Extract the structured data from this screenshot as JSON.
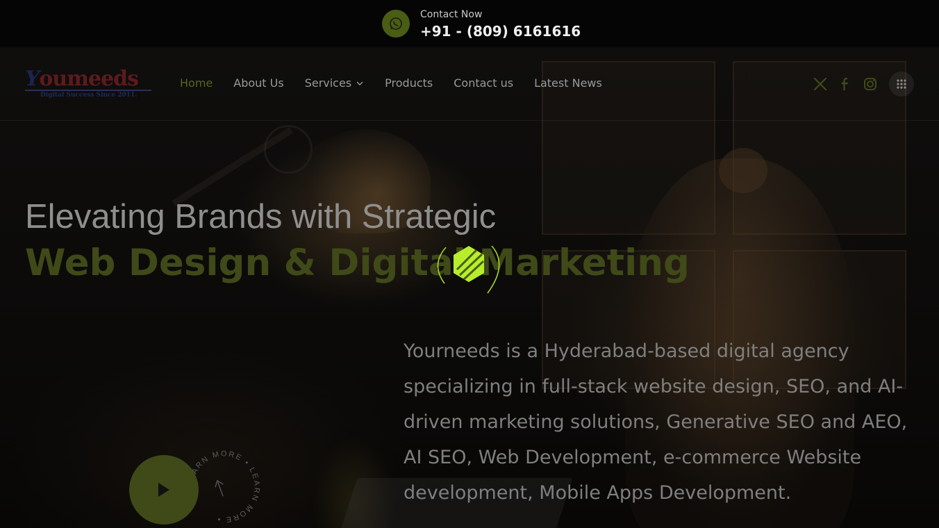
{
  "contact": {
    "label": "Contact Now",
    "phone": "+91 - (809) 6161616",
    "icon": "whatsapp-icon"
  },
  "logo": {
    "letter": "Y",
    "rest": "oumeeds",
    "tagline": "Digital Success Since 2011."
  },
  "nav": {
    "items": [
      {
        "label": "Home",
        "active": true
      },
      {
        "label": "About Us",
        "active": false
      },
      {
        "label": "Services",
        "active": false,
        "has_dropdown": true
      },
      {
        "label": "Products",
        "active": false
      },
      {
        "label": "Contact us",
        "active": false
      },
      {
        "label": "Latest News",
        "active": false
      }
    ],
    "socials": [
      "x-twitter-icon",
      "facebook-icon",
      "instagram-icon"
    ],
    "menu_icon": "grid-menu-icon"
  },
  "hero": {
    "headline_light": "Elevating Brands with Strategic",
    "headline_bold": "Web Design & Digital Marketing",
    "description": "Yourneeds is a Hyderabad-based digital agency specializing in full-stack website design, SEO, and AI-driven marketing solutions, Generative SEO and AEO, AI SEO,  Web Development, e-commerce Website development, Mobile Apps Development.",
    "learn_more": "LEARN MORE • LEARN MORE •"
  },
  "colors": {
    "accent": "#c6ff2e",
    "accent_dim": "#3f4a18",
    "background": "#000000"
  }
}
